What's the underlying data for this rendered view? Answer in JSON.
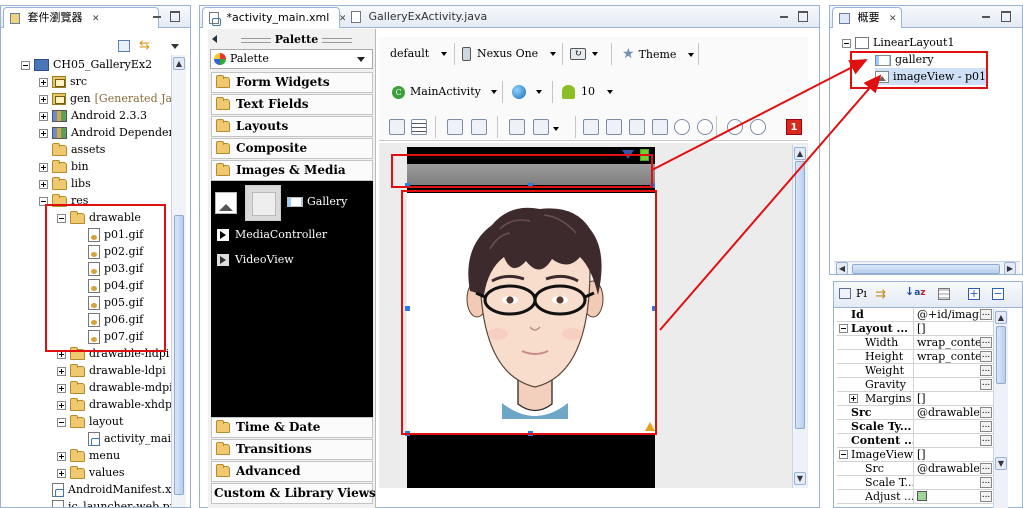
{
  "package_explorer": {
    "tab_title": "套件瀏覽器",
    "close_glyph": "✕",
    "tree": [
      {
        "label": "CH05_GalleryEx2",
        "icon": "project-icon",
        "indent": 0,
        "expander": "minus"
      },
      {
        "label": "src",
        "icon": "package-icon",
        "indent": 1,
        "expander": "plus"
      },
      {
        "label": "gen",
        "sub": "[Generated Java",
        "icon": "package-icon",
        "indent": 1,
        "expander": "plus"
      },
      {
        "label": "Android 2.3.3",
        "icon": "library-icon",
        "indent": 1,
        "expander": "plus"
      },
      {
        "label": "Android Dependenc",
        "icon": "library-icon",
        "indent": 1,
        "expander": "plus"
      },
      {
        "label": "assets",
        "icon": "folder-icon",
        "indent": 1,
        "expander": "none"
      },
      {
        "label": "bin",
        "icon": "folder-icon",
        "indent": 1,
        "expander": "plus"
      },
      {
        "label": "libs",
        "icon": "folder-icon",
        "indent": 1,
        "expander": "plus"
      },
      {
        "label": "res",
        "icon": "folder-icon",
        "indent": 1,
        "expander": "minus"
      },
      {
        "label": "drawable",
        "icon": "folder-icon",
        "indent": 2,
        "expander": "minus"
      },
      {
        "label": "p01.gif",
        "icon": "gif-file-icon",
        "indent": 3,
        "expander": "none"
      },
      {
        "label": "p02.gif",
        "icon": "gif-file-icon",
        "indent": 3,
        "expander": "none"
      },
      {
        "label": "p03.gif",
        "icon": "gif-file-icon",
        "indent": 3,
        "expander": "none"
      },
      {
        "label": "p04.gif",
        "icon": "gif-file-icon",
        "indent": 3,
        "expander": "none"
      },
      {
        "label": "p05.gif",
        "icon": "gif-file-icon",
        "indent": 3,
        "expander": "none"
      },
      {
        "label": "p06.gif",
        "icon": "gif-file-icon",
        "indent": 3,
        "expander": "none"
      },
      {
        "label": "p07.gif",
        "icon": "gif-file-icon",
        "indent": 3,
        "expander": "none"
      },
      {
        "label": "drawable-hdpi",
        "icon": "folder-icon",
        "indent": 2,
        "expander": "plus"
      },
      {
        "label": "drawable-ldpi",
        "icon": "folder-icon",
        "indent": 2,
        "expander": "plus"
      },
      {
        "label": "drawable-mdpi",
        "icon": "folder-icon",
        "indent": 2,
        "expander": "plus"
      },
      {
        "label": "drawable-xhdpi",
        "icon": "folder-icon",
        "indent": 2,
        "expander": "plus"
      },
      {
        "label": "layout",
        "icon": "folder-icon",
        "indent": 2,
        "expander": "minus"
      },
      {
        "label": "activity_mai",
        "icon": "xml-file-icon",
        "indent": 3,
        "expander": "none"
      },
      {
        "label": "menu",
        "icon": "folder-icon",
        "indent": 2,
        "expander": "plus"
      },
      {
        "label": "values",
        "icon": "folder-icon",
        "indent": 2,
        "expander": "plus"
      },
      {
        "label": "AndroidManifest.xm",
        "icon": "xml-file-icon",
        "indent": 1,
        "expander": "none"
      },
      {
        "label": "ic_launcher-web.pn",
        "icon": "png-file-icon",
        "indent": 1,
        "expander": "none"
      }
    ]
  },
  "editor": {
    "tabs": [
      {
        "label": "*activity_main.xml",
        "active": true
      },
      {
        "label": "GalleryExActivity.java",
        "active": false
      }
    ],
    "close_glyph": "✕",
    "config_toolbar": {
      "config": "default",
      "device": "Nexus One",
      "theme": "Theme",
      "activity": "MainActivity",
      "api": "10"
    },
    "error_badge": "1"
  },
  "palette": {
    "title": "Palette",
    "dropdown_label": "Palette",
    "categories_top": [
      "Form Widgets",
      "Text Fields",
      "Layouts",
      "Composite",
      "Images & Media"
    ],
    "items": [
      "Gallery",
      "MediaController",
      "VideoView"
    ],
    "categories_bottom": [
      "Time & Date",
      "Transitions",
      "Advanced"
    ],
    "custom_views": "Custom & Library Views"
  },
  "outline": {
    "tab_title": "概要",
    "close_glyph": "✕",
    "root": "LinearLayout1",
    "children": [
      "gallery",
      "imageView - p01"
    ]
  },
  "properties": {
    "tab_label": "Pı",
    "rows": [
      {
        "name": "Id",
        "value": "@+id/imag...",
        "bold": true,
        "indent": 0,
        "expander": "none",
        "dots": true
      },
      {
        "name": "Layout ...",
        "value": "[]",
        "bold": true,
        "indent": 0,
        "expander": "minus",
        "dots": false
      },
      {
        "name": "Width",
        "value": "wrap_content",
        "bold": false,
        "indent": 1,
        "expander": "none",
        "dots": true
      },
      {
        "name": "Height",
        "value": "wrap_content",
        "bold": false,
        "indent": 1,
        "expander": "none",
        "dots": true
      },
      {
        "name": "Weight",
        "value": "",
        "bold": false,
        "indent": 1,
        "expander": "none",
        "dots": true
      },
      {
        "name": "Gravity",
        "value": "",
        "bold": false,
        "indent": 1,
        "expander": "none",
        "dots": true
      },
      {
        "name": "Margins",
        "value": "[]",
        "bold": false,
        "indent": 1,
        "expander": "plus",
        "dots": false
      },
      {
        "name": "Src",
        "value": "@drawable...",
        "bold": true,
        "indent": 0,
        "expander": "none",
        "dots": true
      },
      {
        "name": "Scale Ty...",
        "value": "",
        "bold": true,
        "indent": 0,
        "expander": "none",
        "dots": true
      },
      {
        "name": "Content ...",
        "value": "",
        "bold": true,
        "indent": 0,
        "expander": "none",
        "dots": true
      },
      {
        "name": "ImageView",
        "value": "[]",
        "bold": false,
        "indent": 0,
        "expander": "minus",
        "dots": false
      },
      {
        "name": "Src",
        "value": "@drawable...",
        "bold": false,
        "indent": 1,
        "expander": "none",
        "dots": true
      },
      {
        "name": "Scale T...",
        "value": "",
        "bold": false,
        "indent": 1,
        "expander": "none",
        "dots": true
      },
      {
        "name": "Adjust ...",
        "value": "",
        "bold": false,
        "indent": 1,
        "expander": "none",
        "dots": true,
        "checkbox": true
      }
    ]
  },
  "colors": {
    "annotation_red": "#e01010",
    "selection_blue": "#2a7be4",
    "view_border": "#9ab3d5"
  }
}
